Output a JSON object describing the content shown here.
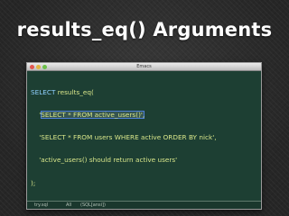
{
  "slide": {
    "title": "results_eq() Arguments"
  },
  "window": {
    "title": "Emacs"
  },
  "editor": {
    "lines": [
      {
        "keyword": "SELECT",
        "text": " results_eq("
      },
      {
        "text": "    '",
        "highlight": "SELECT * FROM active_users()',",
        "after": ""
      },
      {
        "text": "    'SELECT * FROM users WHERE active ORDER BY nick',"
      },
      {
        "text": "    'active_users() should return active users'"
      },
      {
        "text": ");"
      }
    ]
  },
  "statusbar": {
    "buffer": "try.sql",
    "separator": "All",
    "mode": "(SQL[ansi])"
  },
  "colors": {
    "background": "#2b2b2b",
    "editor_background": "#1d3f33",
    "code_text": "#d8e68a",
    "keyword": "#8fd0ff",
    "selection_border": "#4d7fd6"
  }
}
